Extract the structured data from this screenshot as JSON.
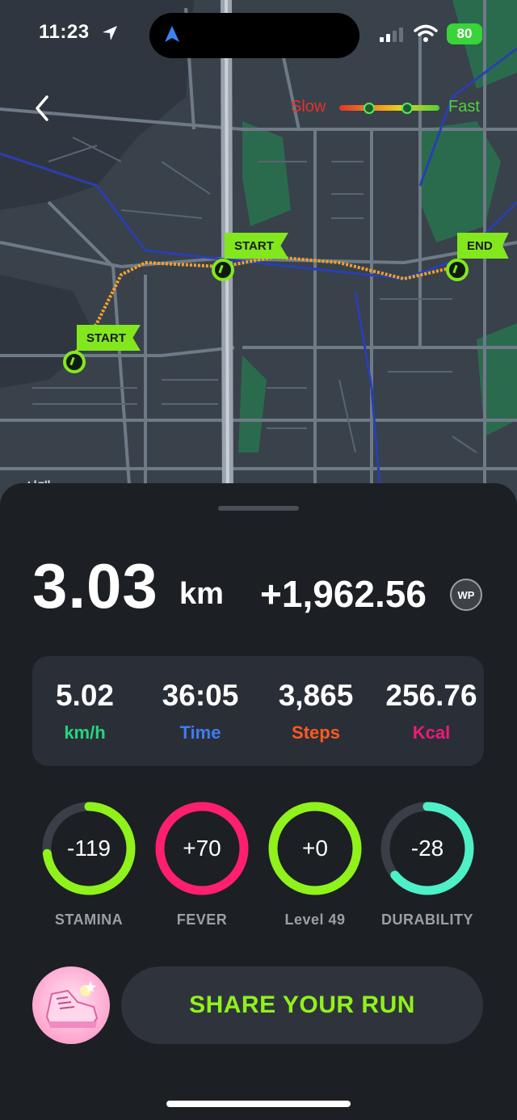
{
  "status_bar": {
    "time": "11:23",
    "battery": "80"
  },
  "map": {
    "legend": {
      "slow": "Slow",
      "fast": "Fast"
    },
    "flags": {
      "start_1": "START",
      "start_2": "START",
      "end": "END"
    },
    "corner_text": "서대"
  },
  "summary": {
    "distance": "3.03",
    "distance_unit": "km",
    "points": "+1,962.56",
    "points_badge": "WP"
  },
  "stats": [
    {
      "value": "5.02",
      "label": "km/h",
      "color": "#27d47f"
    },
    {
      "value": "36:05",
      "label": "Time",
      "color": "#3e7cf0"
    },
    {
      "value": "3,865",
      "label": "Steps",
      "color": "#ff5a1f"
    },
    {
      "value": "256.76",
      "label": "Kcal",
      "color": "#f0197a"
    }
  ],
  "rings": [
    {
      "value": "-119",
      "label": "STAMINA",
      "color": "#8ff21b",
      "fraction": 0.73
    },
    {
      "value": "+70",
      "label": "FEVER",
      "color": "#ff1f6e",
      "fraction": 1.0
    },
    {
      "value": "+0",
      "label": "Level 49",
      "color": "#8ff21b",
      "fraction": 1.0
    },
    {
      "value": "-28",
      "label": "DURABILITY",
      "color": "#4ef0c8",
      "fraction": 0.64
    }
  ],
  "share_button": "SHARE YOUR RUN"
}
